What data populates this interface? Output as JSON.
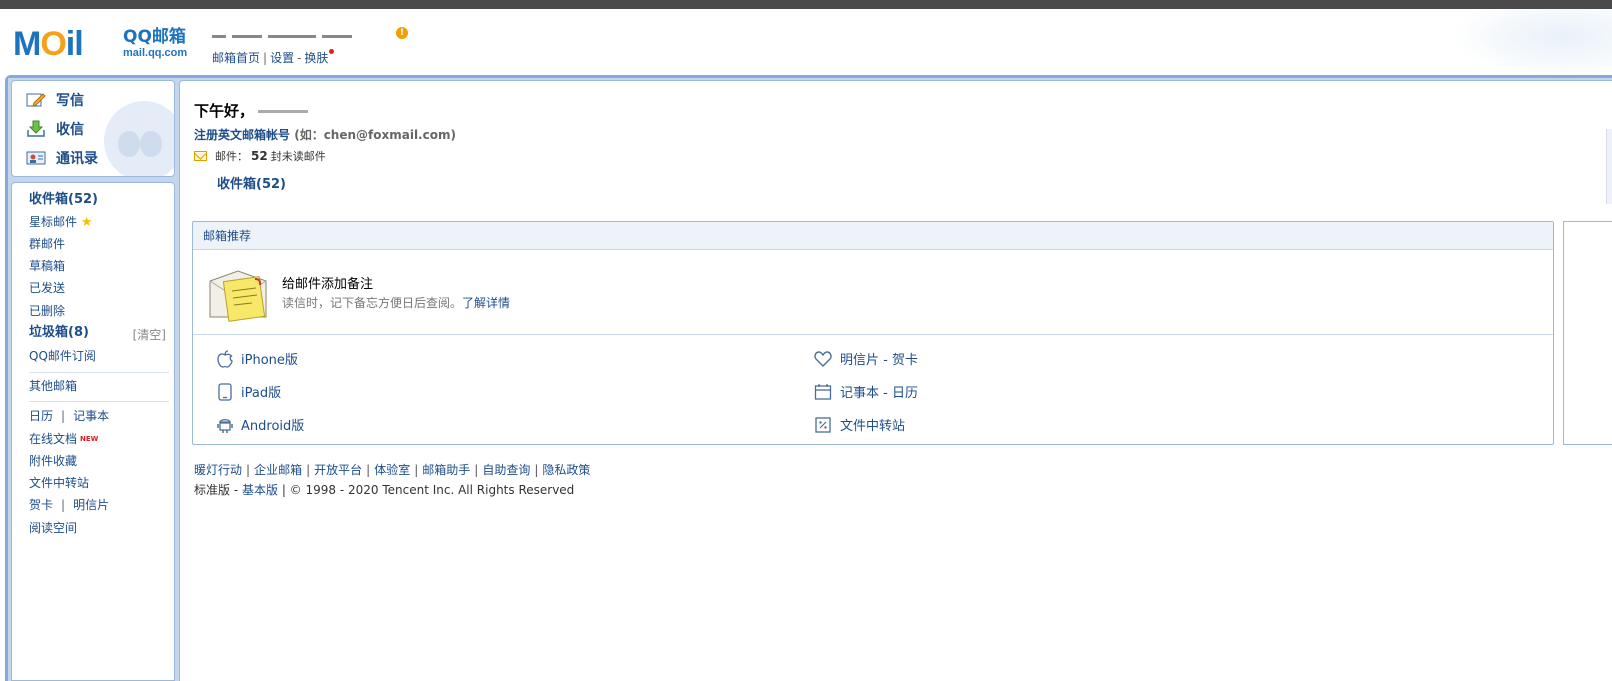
{
  "header": {
    "logo_text": "MOil",
    "logo_brand": "QQ邮箱",
    "logo_url": "mail.qq.com",
    "links": [
      "邮箱首页",
      "设置",
      "换肤"
    ]
  },
  "quick_actions": [
    {
      "label": "写信",
      "icon": "pencil-icon"
    },
    {
      "label": "收信",
      "icon": "download-icon"
    },
    {
      "label": "通讯录",
      "icon": "contacts-icon"
    }
  ],
  "folders": {
    "inbox": "收件箱(52)",
    "starred": "星标邮件",
    "group": "群邮件",
    "drafts": "草稿箱",
    "sent": "已发送",
    "deleted": "已删除",
    "spam": "垃圾箱(8)",
    "spam_clear": "[清空]",
    "subscriptions": "QQ邮件订阅",
    "other_mailboxes": "其他邮箱",
    "calendar": "日历",
    "notebook": "记事本",
    "online_docs": "在线文档",
    "new_badge": "NEW",
    "attachments": "附件收藏",
    "file_transfer": "文件中转站",
    "greeting_card": "贺卡",
    "postcard": "明信片",
    "reading": "阅读空间"
  },
  "main": {
    "greeting": "下午好，",
    "register_link": "注册英文邮箱帐号",
    "register_example": "(如：chen@foxmail.com)",
    "mail_label": "邮件：",
    "unread_count": "52",
    "unread_suffix": "封未读邮件",
    "inbox_link": "收件箱(52)"
  },
  "recommend": {
    "title": "邮箱推荐",
    "feature_title": "给邮件添加备注",
    "feature_desc": "读信时，记下备忘方便日后查阅。",
    "feature_link": "了解详情",
    "apps": [
      {
        "label": "iPhone版",
        "icon": "apple-icon"
      },
      {
        "label": "iPad版",
        "icon": "tablet-icon"
      },
      {
        "label": "Android版",
        "icon": "android-icon"
      },
      {
        "label": "明信片 - 贺卡",
        "icon": "heart-icon"
      },
      {
        "label": "记事本 - 日历",
        "icon": "calendar-icon"
      },
      {
        "label": "文件中转站",
        "icon": "transfer-icon"
      }
    ]
  },
  "footer": {
    "links": [
      "暖灯行动",
      "企业邮箱",
      "开放平台",
      "体验室",
      "邮箱助手",
      "自助查询",
      "隐私政策"
    ],
    "version_standard": "标准版",
    "version_basic": "基本版",
    "copyright": "© 1998 - 2020 Tencent Inc. All Rights Reserved"
  }
}
